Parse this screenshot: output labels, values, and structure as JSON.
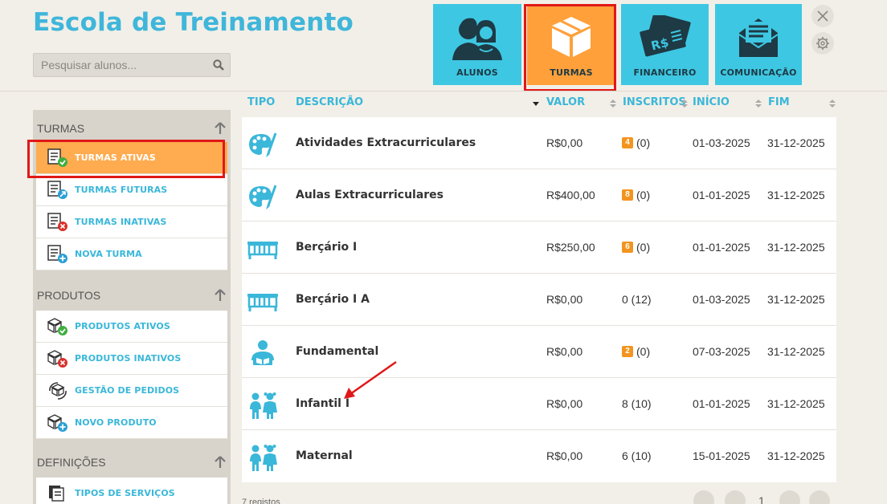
{
  "header": {
    "app_title": "Escola de Treinamento",
    "search_placeholder": "Pesquisar alunos..."
  },
  "nav_tiles": [
    {
      "label": "ALUNOS",
      "icon": "students-icon",
      "active": false
    },
    {
      "label": "TURMAS",
      "icon": "box-icon",
      "active": true
    },
    {
      "label": "FINANCEIRO",
      "icon": "money-bills-icon",
      "active": false
    },
    {
      "label": "COMUNICAÇÃO",
      "icon": "envelope-icon",
      "active": false
    }
  ],
  "sidebar": {
    "sections": [
      {
        "title": "TURMAS",
        "items": [
          {
            "label": "TURMAS ATIVAS",
            "active": true
          },
          {
            "label": "TURMAS FUTURAS"
          },
          {
            "label": "TURMAS INATIVAS"
          },
          {
            "label": "NOVA TURMA"
          }
        ]
      },
      {
        "title": "PRODUTOS",
        "items": [
          {
            "label": "PRODUTOS ATIVOS"
          },
          {
            "label": "PRODUTOS INATIVOS"
          },
          {
            "label": "GESTÃO DE PEDIDOS"
          },
          {
            "label": "NOVO PRODUTO"
          }
        ]
      },
      {
        "title": "DEFINIÇÕES",
        "items": [
          {
            "label": "TIPOS DE SERVIÇOS"
          }
        ]
      }
    ]
  },
  "table": {
    "columns": [
      "TIPO",
      "DESCRIÇÃO",
      "VALOR",
      "INSCRITOS",
      "INÍCIO",
      "FIM"
    ],
    "rows": [
      {
        "icon": "palette-icon",
        "descricao": "Atividades Extracurriculares",
        "valor": "R$0,00",
        "badge": "4",
        "inscritos": "(0)",
        "inicio": "01-03-2025",
        "fim": "31-12-2025"
      },
      {
        "icon": "palette-icon",
        "descricao": "Aulas Extracurriculares",
        "valor": "R$400,00",
        "badge": "8",
        "inscritos": "(0)",
        "inicio": "01-01-2025",
        "fim": "31-12-2025"
      },
      {
        "icon": "crib-icon",
        "descricao": "Berçário I",
        "valor": "R$250,00",
        "badge": "6",
        "inscritos": "(0)",
        "inicio": "01-01-2025",
        "fim": "31-12-2025"
      },
      {
        "icon": "crib-icon",
        "descricao": "Berçário I A",
        "valor": "R$0,00",
        "badge": "",
        "inscritos": "0 (12)",
        "inicio": "01-03-2025",
        "fim": "31-12-2025"
      },
      {
        "icon": "reading-student-icon",
        "descricao": "Fundamental",
        "valor": "R$0,00",
        "badge": "2",
        "inscritos": "(0)",
        "inicio": "07-03-2025",
        "fim": "31-12-2025"
      },
      {
        "icon": "children-icon",
        "descricao": "Infantil I",
        "valor": "R$0,00",
        "badge": "",
        "inscritos": "8 (10)",
        "inicio": "01-01-2025",
        "fim": "31-12-2025"
      },
      {
        "icon": "children-icon",
        "descricao": "Maternal",
        "valor": "R$0,00",
        "badge": "",
        "inscritos": "6 (10)",
        "inicio": "15-01-2025",
        "fim": "31-12-2025"
      }
    ]
  },
  "footer": {
    "count_text": "7 registos",
    "page": "1"
  },
  "colors": {
    "accent": "#3ec7e2",
    "active": "#ffa03a",
    "highlight": "#e01818"
  }
}
